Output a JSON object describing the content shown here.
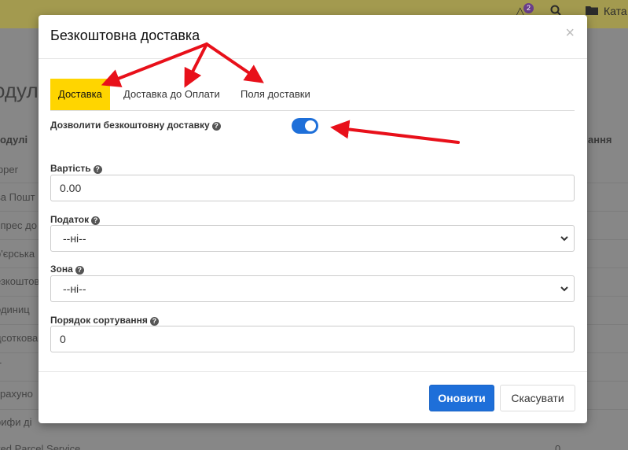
{
  "background": {
    "topbar": {
      "badge_count": "2",
      "catalog_label": "Ката"
    },
    "heading": "одулі",
    "col_left": "одулі",
    "col_right": "ання",
    "rows": [
      "ipper",
      "ва Пошт",
      "спрес до",
      "р'єрська",
      "езкоштов",
      " одиниц",
      "дсоткова",
      "T",
      "зрахуно",
      "рифи ді",
      "ited Parcel Service"
    ],
    "right_value": "0"
  },
  "modal": {
    "title": "Безкоштовна доставка",
    "close_label": "×",
    "tabs": [
      {
        "label": "Доставка",
        "active": true
      },
      {
        "label": "Доставка до Оплати",
        "active": false
      },
      {
        "label": "Поля доставки",
        "active": false
      }
    ],
    "toggle": {
      "label": "Дозволити безкоштовну доставку",
      "enabled": true
    },
    "fields": {
      "cost": {
        "label": "Вартість",
        "value": "0.00"
      },
      "tax": {
        "label": "Податок",
        "selected": "--ні--"
      },
      "zone": {
        "label": "Зона",
        "selected": "--ні--"
      },
      "sort_order": {
        "label": "Порядок сортування",
        "value": "0"
      }
    },
    "buttons": {
      "update": "Оновити",
      "cancel": "Скасувати"
    }
  },
  "help_glyph": "?",
  "icons": {
    "search": "search-icon",
    "folder": "folder-icon",
    "help": "question-circle-icon",
    "chevron": "chevron-down-icon"
  },
  "colors": {
    "accent": "#1e6fd9",
    "active_tab": "#ffd500",
    "arrow": "#e8101a",
    "overlay": "#8a8a8a"
  }
}
